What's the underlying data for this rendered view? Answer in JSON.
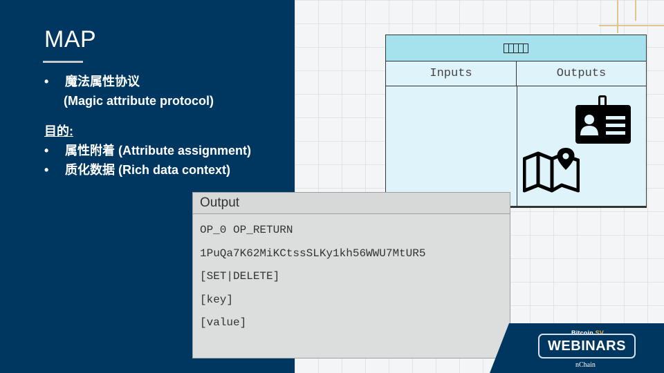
{
  "slide": {
    "title": "MAP",
    "bullets": [
      {
        "marker": "•",
        "text": "魔法属性协议",
        "sub": "(Magic attribute protocol)"
      }
    ],
    "purpose_label": "目的:",
    "purpose_bullets": [
      {
        "marker": "•",
        "text": "属性附着 (Attribute assignment)"
      },
      {
        "marker": "•",
        "text": "质化数据 (Rich data context)"
      }
    ]
  },
  "transaction": {
    "header_icon": "placeholder-boxes-icon",
    "inputs_label": "Inputs",
    "outputs_label": "Outputs",
    "icons": [
      "id-card-icon",
      "map-pin-icon"
    ]
  },
  "output": {
    "title": "Output",
    "lines": [
      "OP_0 OP_RETURN",
      "1PuQa7K62MiKCtssSLKy1kh56WWU7MtUR5",
      "[SET|DELETE]",
      "[key]",
      "[value]"
    ]
  },
  "badge": {
    "top_prefix": "Bitcoin",
    "top_accent": "SV",
    "main": "WEBINARS",
    "bottom": "nChain"
  },
  "colors": {
    "navy": "#003760",
    "table_header": "#a6e1ee",
    "table_body": "#dff3fa",
    "output_bg": "#dcdede",
    "accent_gold": "#e1c58f"
  }
}
